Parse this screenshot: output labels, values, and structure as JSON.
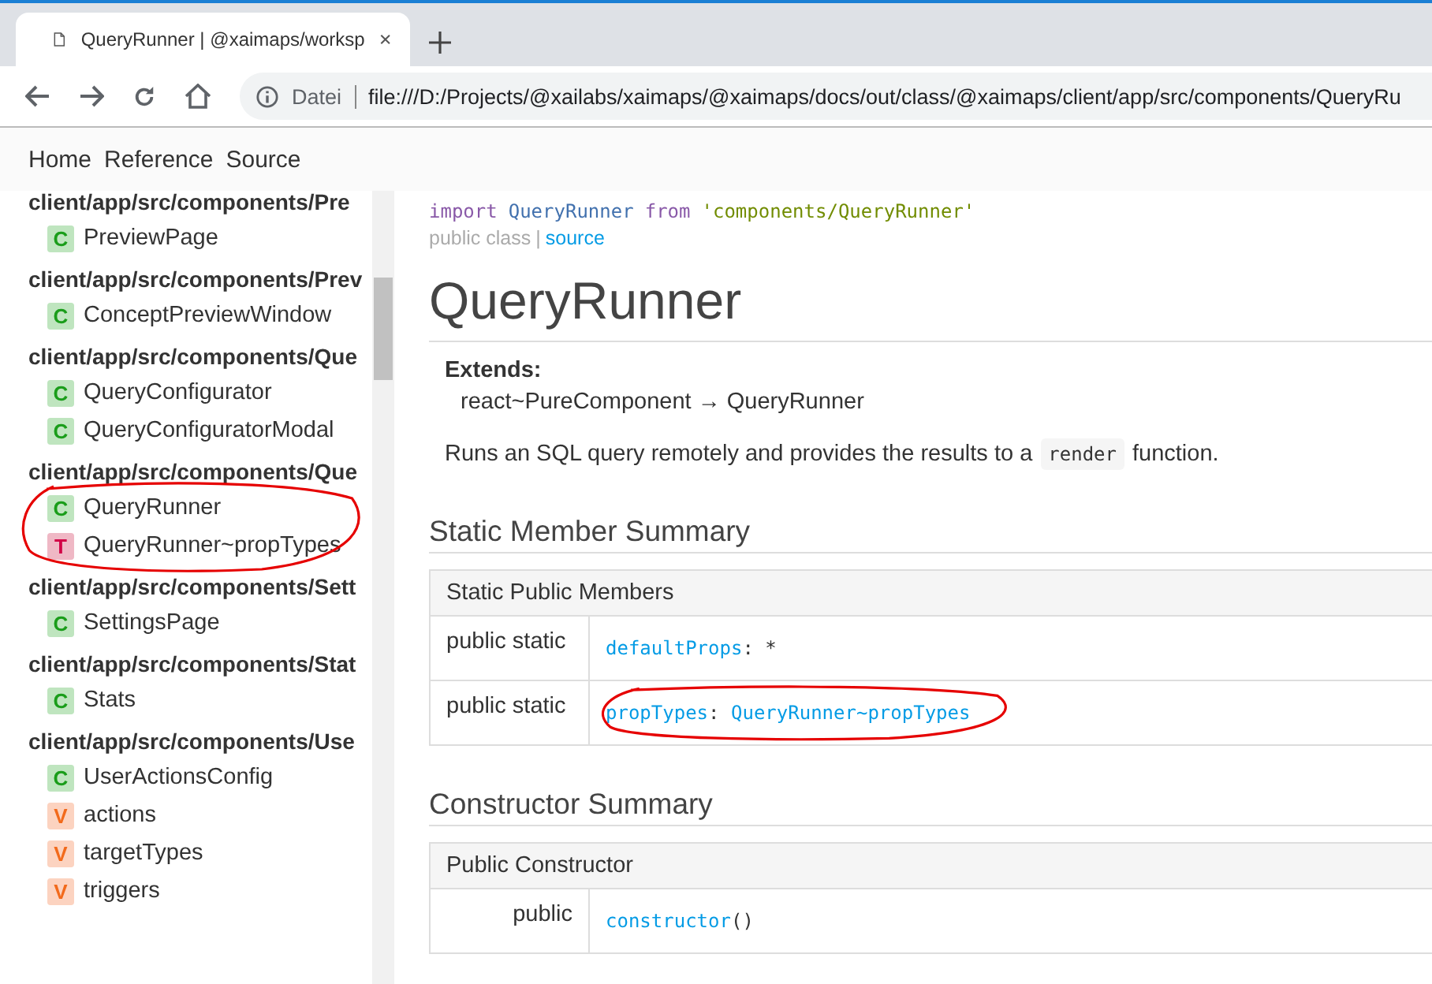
{
  "browser": {
    "tab_title": "QueryRunner | @xaimaps/worksp",
    "address_label": "Datei",
    "url": "file:///D:/Projects/@xailabs/xaimaps/@xaimaps/docs/out/class/@xaimaps/client/app/src/components/QueryRu"
  },
  "nav": [
    "Home",
    "Reference",
    "Source"
  ],
  "sidebar": {
    "groups": [
      {
        "heading": "client/app/src/components/Pre",
        "circled": false,
        "items": [
          {
            "badge": "C",
            "kind": "class",
            "label": "PreviewPage"
          }
        ]
      },
      {
        "heading": "client/app/src/components/Prev",
        "circled": false,
        "items": [
          {
            "badge": "C",
            "kind": "class",
            "label": "ConceptPreviewWindow"
          }
        ]
      },
      {
        "heading": "client/app/src/components/Que",
        "circled": false,
        "items": [
          {
            "badge": "C",
            "kind": "class",
            "label": "QueryConfigurator"
          },
          {
            "badge": "C",
            "kind": "class",
            "label": "QueryConfiguratorModal"
          }
        ]
      },
      {
        "heading": "client/app/src/components/Que",
        "circled": true,
        "items": [
          {
            "badge": "C",
            "kind": "class",
            "label": "QueryRunner"
          },
          {
            "badge": "T",
            "kind": "typedef",
            "label": "QueryRunner~propTypes"
          }
        ]
      },
      {
        "heading": "client/app/src/components/Sett",
        "circled": false,
        "items": [
          {
            "badge": "C",
            "kind": "class",
            "label": "SettingsPage"
          }
        ]
      },
      {
        "heading": "client/app/src/components/Stat",
        "circled": false,
        "items": [
          {
            "badge": "C",
            "kind": "class",
            "label": "Stats"
          }
        ]
      },
      {
        "heading": "client/app/src/components/Use",
        "circled": false,
        "items": [
          {
            "badge": "C",
            "kind": "class",
            "label": "UserActionsConfig"
          },
          {
            "badge": "V",
            "kind": "variable",
            "label": "actions"
          },
          {
            "badge": "V",
            "kind": "variable",
            "label": "targetTypes"
          },
          {
            "badge": "V",
            "kind": "variable",
            "label": "triggers"
          }
        ]
      }
    ]
  },
  "content": {
    "import_line": [
      {
        "kind": "keyword",
        "text": "import"
      },
      {
        "kind": "name",
        "text": "QueryRunner"
      },
      {
        "kind": "keyword",
        "text": "from"
      },
      {
        "kind": "string",
        "text": "'components/QueryRunner'"
      }
    ],
    "access": "public class",
    "separator": "|",
    "source_link": "source",
    "title": "QueryRunner",
    "extends_label": "Extends:",
    "extends_chain": "react~PureComponent → QueryRunner",
    "description_before": "Runs an SQL query remotely and provides the results to a",
    "description_code": "render",
    "description_after": "function.",
    "sections": [
      {
        "heading": "Static Member Summary",
        "table_title": "Static Public Members",
        "rows": [
          {
            "modifier": "public static",
            "name": "defaultProps",
            "colon": ":",
            "type": "*",
            "type_link": false,
            "circled": false
          },
          {
            "modifier": "public static",
            "name": "propTypes",
            "colon": ":",
            "type": "QueryRunner~propTypes",
            "type_link": true,
            "circled": true
          }
        ]
      },
      {
        "heading": "Constructor Summary",
        "table_title": "Public Constructor",
        "rows": [
          {
            "modifier": "public",
            "name": "constructor",
            "type": "()",
            "type_link": false,
            "circled": false
          }
        ]
      }
    ]
  }
}
